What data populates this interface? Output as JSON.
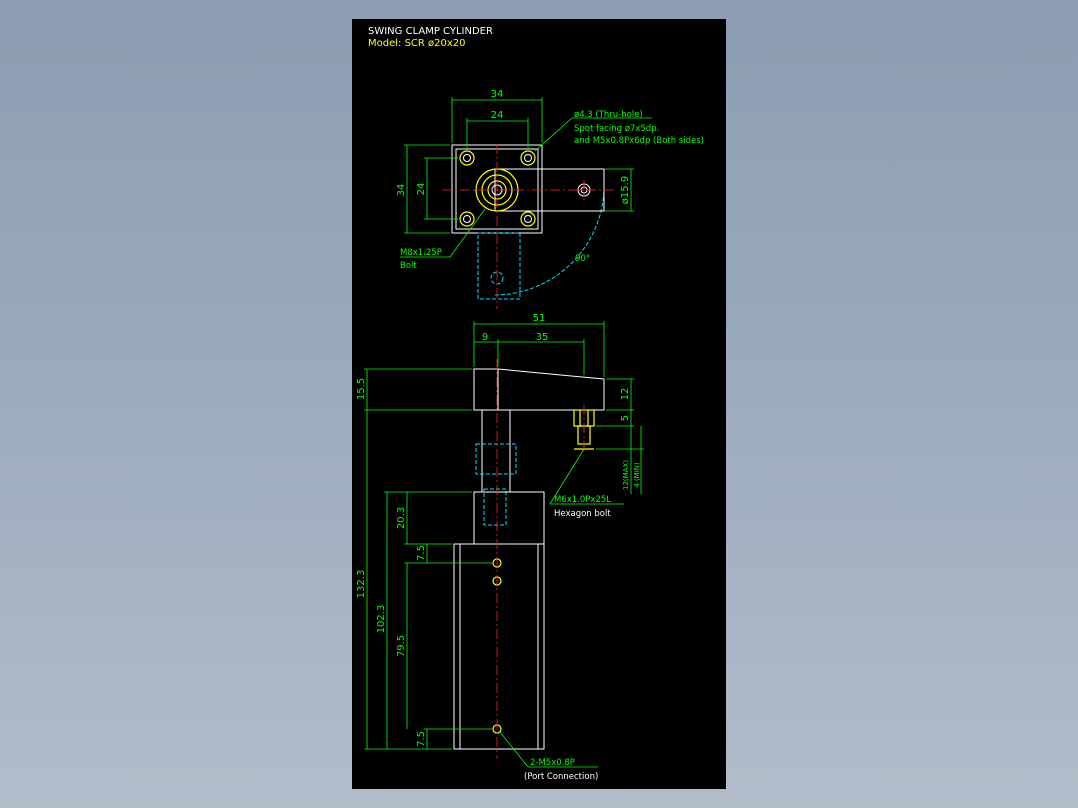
{
  "title": {
    "line1": "SWING CLAMP CYLINDER",
    "line2": "Model:  SCR  ø20x20"
  },
  "top_view": {
    "dim_34_top": "34",
    "dim_24_top": "24",
    "dim_34_side": "34",
    "dim_24_side": "24",
    "dim_phi159": "ø15.9",
    "angle": "90°",
    "callout_hole_1": "ø4.3 (Thru-hole)",
    "callout_hole_2": "Spot facing ø7x5dp.",
    "callout_hole_3": "and M5x0.8Px6dp (Both sides)",
    "callout_bolt_1": "M8x1.25P",
    "callout_bolt_2": "Bolt"
  },
  "side_view": {
    "dim_51": "51",
    "dim_9": "9",
    "dim_35": "35",
    "dim_155": "15.5",
    "dim_12": "12",
    "dim_5": "5",
    "dim_12max": "12(MAX)",
    "dim_4min": "4 (MIN)",
    "callout_hex_1": "M6x1.0Px25L",
    "callout_hex_2": "Hexagon bolt",
    "dim_1323": "132.3",
    "dim_1023": "102.3",
    "dim_203": "20.3",
    "dim_75_top": "7.5",
    "dim_795": "79.5",
    "dim_75_bottom": "7.5",
    "callout_port_1": "2-M5x0.8P",
    "callout_port_2": "(Port Connection)"
  },
  "colors": {
    "background": "#000000",
    "outline": "#ffffff",
    "dimension": "#00ff00",
    "centerline": "#ff2020",
    "hidden": "#00e0ff",
    "highlight": "#ffff00"
  }
}
